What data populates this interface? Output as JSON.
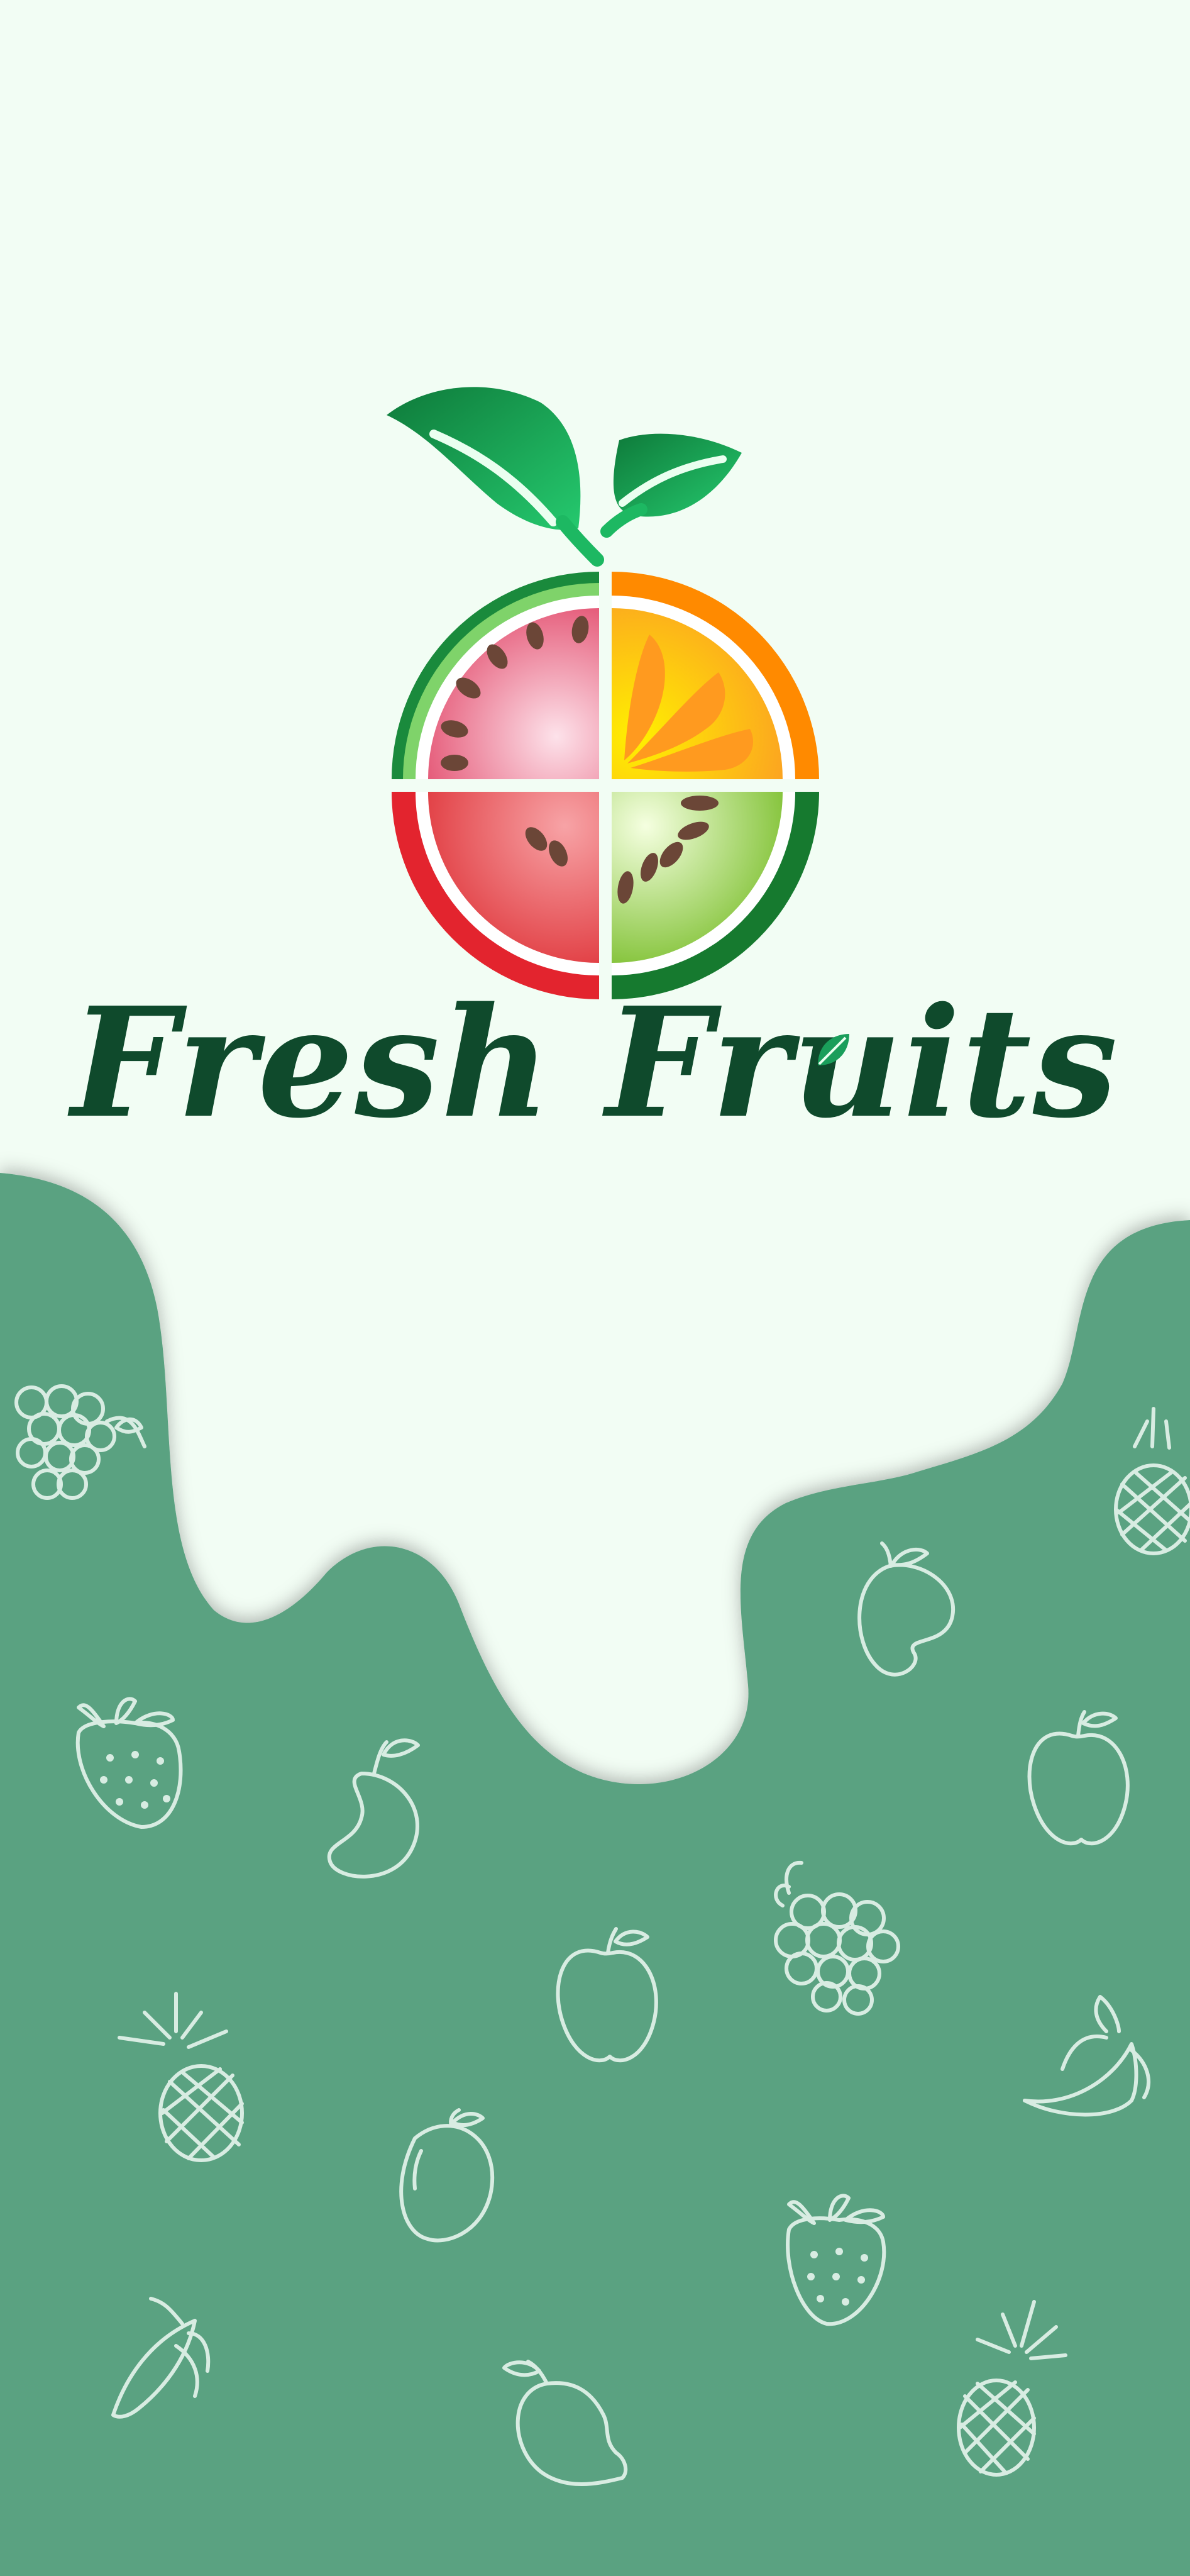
{
  "app": {
    "title": "Fresh Fruits"
  },
  "colors": {
    "background": "#f2fdf4",
    "wave": "#5aa281",
    "title": "#0f4a2c",
    "leaf": "#1a9e5b",
    "outline": "#d8ece2"
  },
  "icons": [
    "grapes-icon",
    "pineapple-icon",
    "mango-icon",
    "strawberry-icon",
    "apple-icon",
    "lemon-icon",
    "banana-icon"
  ]
}
